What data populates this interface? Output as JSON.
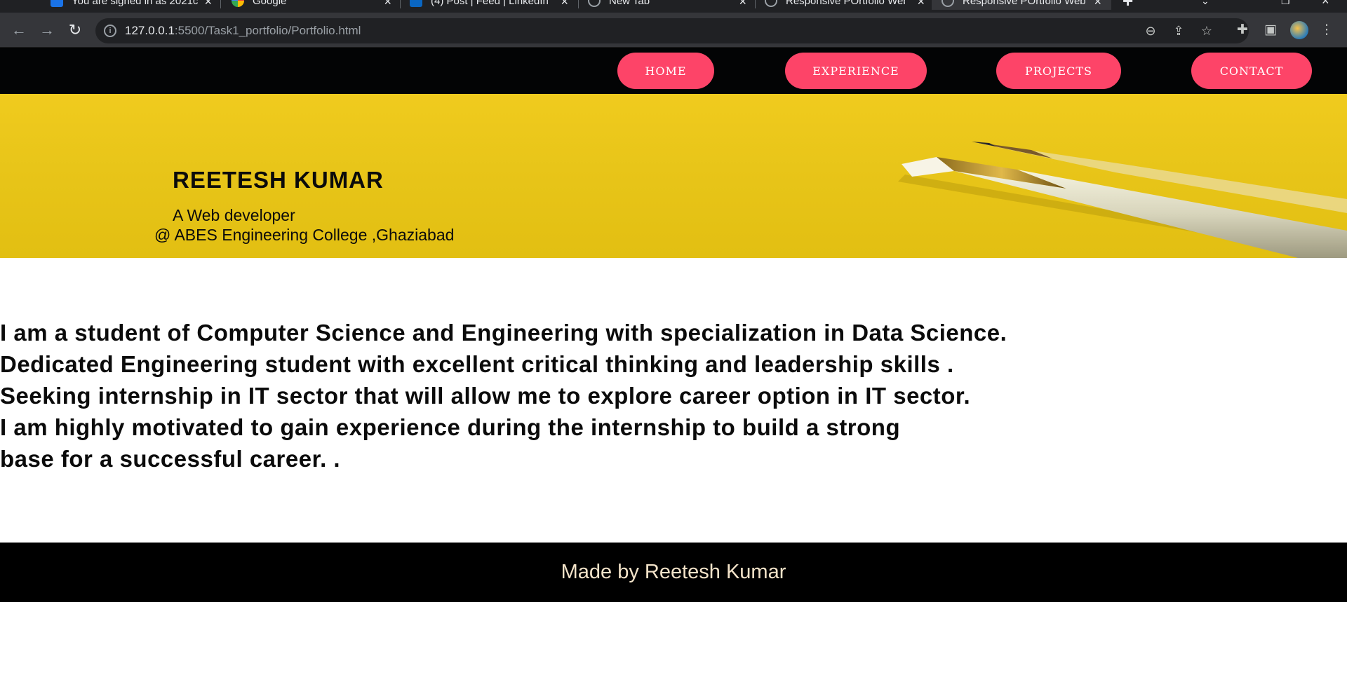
{
  "browser": {
    "tabs": [
      {
        "title": "You are signed in as 2021c",
        "favicon_color": "#1a73e8"
      },
      {
        "title": "Google",
        "favicon_color": "#ea4335"
      },
      {
        "title": "(4) Post | Feed | LinkedIn",
        "favicon_color": "#0a66c2"
      },
      {
        "title": "New Tab",
        "favicon_color": "#8ab4f8"
      },
      {
        "title": "Responsive POrtfolio Web",
        "favicon_color": "#8ab4f8"
      },
      {
        "title": "Responsive POrtfolio Web",
        "favicon_color": "#8ab4f8"
      }
    ],
    "active_tab_index": 5,
    "url_host": "127.0.0.1",
    "url_rest": ":5500/Task1_portfolio/Portfolio.html",
    "icons": {
      "back": "back-arrow-icon",
      "forward": "forward-arrow-icon",
      "reload": "reload-icon",
      "zoom": "zoom-out-icon",
      "share": "share-icon",
      "bookmark": "star-icon",
      "extensions": "puzzle-icon",
      "side_panel": "side-panel-icon",
      "menu": "kebab-menu-icon"
    }
  },
  "nav": {
    "home": "HOME",
    "experience": "EXPERIENCE",
    "projects": "PROJECTS",
    "contact": "CONTACT",
    "pill_color": "#fd4468",
    "bar_color": "#030405"
  },
  "hero": {
    "name": "REETESH KUMAR",
    "role": "A Web developer",
    "college": "@ ABES Engineering College ,Ghaziabad",
    "background_color": "#e8c519"
  },
  "about": {
    "lines": [
      "I am a student of Computer Science and Engineering with specialization in Data Science.",
      "Dedicated Engineering student with excellent critical thinking and leadership skills .",
      "Seeking internship in IT sector that will allow me to explore career option in IT sector.",
      "I am highly motivated to gain experience during the internship to build a strong",
      "base for a successful career. ."
    ]
  },
  "footer": {
    "text": "Made by Reetesh Kumar",
    "text_color": "#f3e3c9"
  }
}
